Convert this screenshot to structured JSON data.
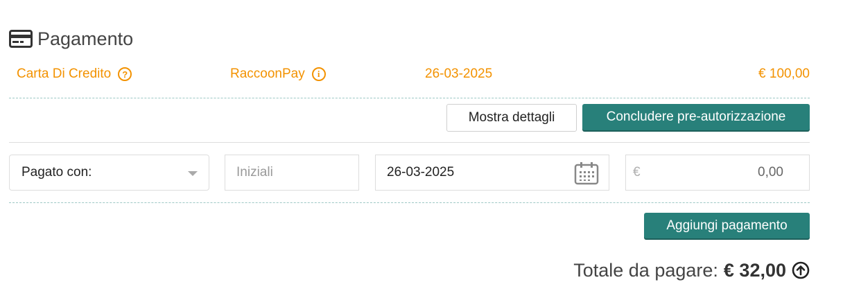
{
  "header": {
    "title": "Pagamento",
    "icon": "credit-card-icon"
  },
  "payment": {
    "method": "Carta Di Credito",
    "provider": "RaccoonPay",
    "date": "26-03-2025",
    "amount": "€ 100,00",
    "accent_color": "#f39200"
  },
  "actions": {
    "details_label": "Mostra dettagli",
    "preauth_label": "Concludere pre-autorizzazione",
    "teal_color": "#28807a"
  },
  "form": {
    "paid_with_label": "Pagato con:",
    "initials_placeholder": "Iniziali",
    "date_value": "26-03-2025",
    "currency_symbol": "€",
    "amount_value": "0,00",
    "add_payment_label": "Aggiungi pagamento"
  },
  "total": {
    "label": "Totale da pagare:",
    "amount": "€ 32,00"
  }
}
